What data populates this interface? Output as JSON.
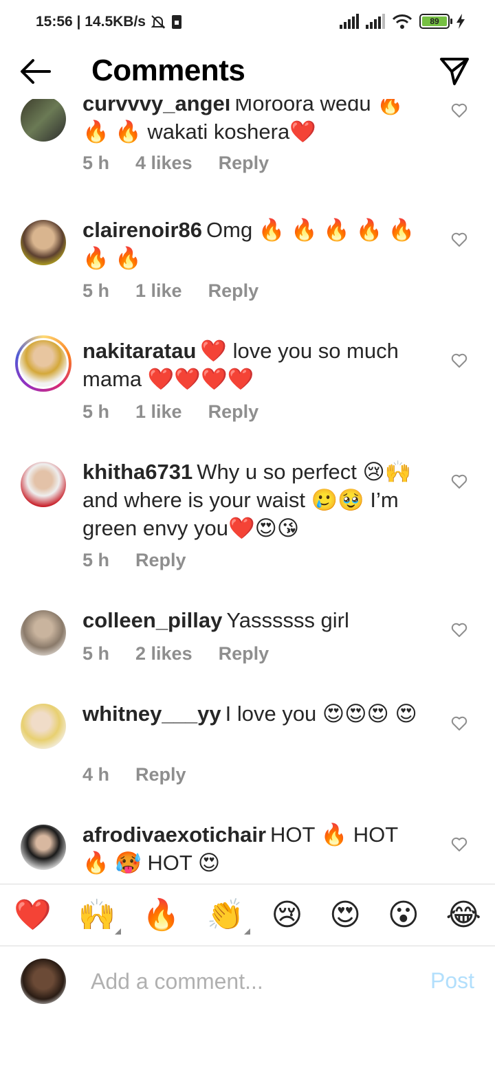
{
  "status_bar": {
    "time": "15:56 | 14.5KB/s",
    "battery": "89"
  },
  "header": {
    "title": "Comments"
  },
  "comments": [
    {
      "username": "curvvvy_angel",
      "text": "Moroora wedu 🔥🔥 🔥  wakati koshera❤️",
      "time": "5 h",
      "likes": "4 likes",
      "reply": "Reply"
    },
    {
      "username": "clairenoir86",
      "text": "Omg 🔥 🔥 🔥 🔥 🔥 🔥 🔥",
      "time": "5 h",
      "likes": "1 like",
      "reply": "Reply"
    },
    {
      "username": "nakitaratau",
      "text": "❤️ love you so much mama ❤️❤️❤️❤️",
      "time": "5 h",
      "likes": "1 like",
      "reply": "Reply"
    },
    {
      "username": "khitha6731",
      "text": "Why u so perfect 😢🙌and where is your waist 🥲🥹 I’m green envy you❤️😍😘",
      "time": "5 h",
      "likes": "",
      "reply": "Reply"
    },
    {
      "username": "colleen_pillay",
      "text": "Yassssss girl",
      "time": "5 h",
      "likes": "2 likes",
      "reply": "Reply"
    },
    {
      "username": "whitney___yy",
      "text": "I love you 😍😍😍 😍",
      "time": "4 h",
      "likes": "",
      "reply": "Reply"
    },
    {
      "username": "afrodivaexotichair",
      "text": "HOT 🔥  HOT 🔥 🥵  HOT 😍",
      "time": "",
      "likes": "",
      "reply": ""
    }
  ],
  "emoji_bar": [
    "❤️",
    "🙌",
    "🔥",
    "👏",
    "😢",
    "😍",
    "😮",
    "😂"
  ],
  "input": {
    "placeholder": "Add a comment...",
    "post_label": "Post"
  }
}
